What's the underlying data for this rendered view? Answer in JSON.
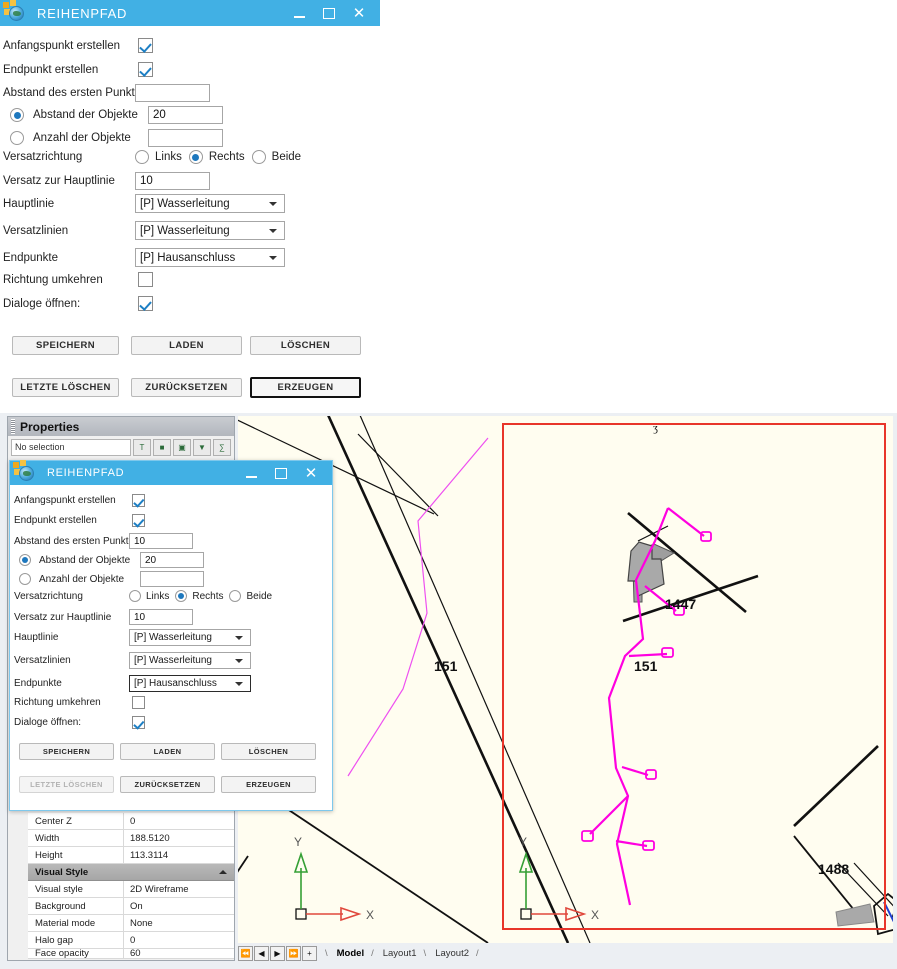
{
  "dialog_primary": {
    "title": "REIHENPFAD",
    "window_buttons": {
      "minimize": "minimize-icon",
      "maximize": "maximize-icon",
      "close": "close-icon"
    },
    "fields": {
      "anfangspunkt_label": "Anfangspunkt erstellen",
      "anfangspunkt_checked": true,
      "endpunkt_label": "Endpunkt erstellen",
      "endpunkt_checked": true,
      "abstand_erster_label": "Abstand des ersten Punktes",
      "abstand_erster_value": "",
      "abstand_objekte_label": "Abstand der Objekte",
      "abstand_objekte_value": "20",
      "abstand_objekte_selected": true,
      "anzahl_objekte_label": "Anzahl der Objekte",
      "anzahl_objekte_value": "",
      "anzahl_objekte_selected": false,
      "versatzrichtung_label": "Versatzrichtung",
      "versatz_links_label": "Links",
      "versatz_rechts_label": "Rechts",
      "versatz_beide_label": "Beide",
      "versatz_selected": "Rechts",
      "versatz_hauptlinie_label": "Versatz zur Hauptlinie",
      "versatz_hauptlinie_value": "10",
      "hauptlinie_label": "Hauptlinie",
      "hauptlinie_value": "[P] Wasserleitung",
      "versatzlinien_label": "Versatzlinien",
      "versatzlinien_value": "[P] Wasserleitung",
      "endpunkte_label": "Endpunkte",
      "endpunkte_value": "[P] Hausanschluss",
      "richtung_umkehren_label": "Richtung umkehren",
      "richtung_umkehren_checked": false,
      "dialoge_oeffnen_label": "Dialoge öffnen:",
      "dialoge_oeffnen_checked": true
    },
    "buttons": {
      "speichern": "SPEICHERN",
      "laden": "LADEN",
      "loeschen": "LÖSCHEN",
      "letzte_loeschen": "LETZTE LÖSCHEN",
      "zuruecksetzen": "ZURÜCKSETZEN",
      "erzeugen": "ERZEUGEN",
      "erzeugen_is_default": true,
      "letzte_loeschen_disabled": false
    }
  },
  "dialog_secondary": {
    "title": "REIHENPFAD",
    "fields": {
      "anfangspunkt_label": "Anfangspunkt erstellen",
      "anfangspunkt_checked": true,
      "endpunkt_label": "Endpunkt erstellen",
      "endpunkt_checked": true,
      "abstand_erster_label": "Abstand des ersten Punktes",
      "abstand_erster_value": "10",
      "abstand_objekte_label": "Abstand der Objekte",
      "abstand_objekte_value": "20",
      "abstand_objekte_selected": true,
      "anzahl_objekte_label": "Anzahl der Objekte",
      "anzahl_objekte_value": "",
      "anzahl_objekte_selected": false,
      "versatzrichtung_label": "Versatzrichtung",
      "versatz_links_label": "Links",
      "versatz_rechts_label": "Rechts",
      "versatz_beide_label": "Beide",
      "versatz_selected": "Rechts",
      "versatz_hauptlinie_label": "Versatz zur Hauptlinie",
      "versatz_hauptlinie_value": "10",
      "hauptlinie_label": "Hauptlinie",
      "hauptlinie_value": "[P] Wasserleitung",
      "versatzlinien_label": "Versatzlinien",
      "versatzlinien_value": "[P] Wasserleitung",
      "endpunkte_label": "Endpunkte",
      "endpunkte_value": "[P] Hausanschluss",
      "richtung_umkehren_label": "Richtung umkehren",
      "richtung_umkehren_checked": false,
      "dialoge_oeffnen_label": "Dialoge öffnen:",
      "dialoge_oeffnen_checked": true
    },
    "buttons": {
      "speichern": "SPEICHERN",
      "laden": "LADEN",
      "loeschen": "LÖSCHEN",
      "letzte_loeschen": "LETZTE LÖSCHEN",
      "zuruecksetzen": "ZURÜCKSETZEN",
      "erzeugen": "ERZEUGEN",
      "erzeugen_is_default": false,
      "letzte_loeschen_disabled": true
    }
  },
  "properties_panel": {
    "header": "Properties",
    "selection": "No selection",
    "toolbar_icons": [
      "text-style-icon",
      "quick-select-icon",
      "select-objects-icon",
      "filter-icon",
      "quick-calc-icon"
    ],
    "rows": [
      {
        "key": "Center Z",
        "value": "0"
      },
      {
        "key": "Width",
        "value": "188.5120"
      },
      {
        "key": "Height",
        "value": "113.3114"
      }
    ],
    "category": "Visual Style",
    "category_rows": [
      {
        "key": "Visual style",
        "value": "2D Wireframe"
      },
      {
        "key": "Background",
        "value": "On"
      },
      {
        "key": "Material mode",
        "value": "None"
      },
      {
        "key": "Halo gap",
        "value": "0"
      },
      {
        "key": "Face opacity",
        "value": "60"
      }
    ]
  },
  "drawing": {
    "tabs": {
      "model": "Model",
      "layout1": "Layout1",
      "layout2": "Layout2",
      "active": "Model"
    },
    "nav_buttons": [
      "first-tab-icon",
      "prev-tab-icon",
      "next-tab-icon",
      "last-tab-icon",
      "new-tab-icon"
    ],
    "parcel_labels": [
      "151",
      "151",
      "1447",
      "1488"
    ],
    "ucs_axis_x": "X",
    "ucs_axis_y": "Y",
    "colors": {
      "pipe_magenta": "#ff00e0",
      "selection_red": "#e8352a",
      "canvas_bg": "#fffdf0",
      "title_blue": "#41b0e4",
      "axis_x_red": "#e0483c",
      "axis_y_green": "#35a035"
    }
  }
}
